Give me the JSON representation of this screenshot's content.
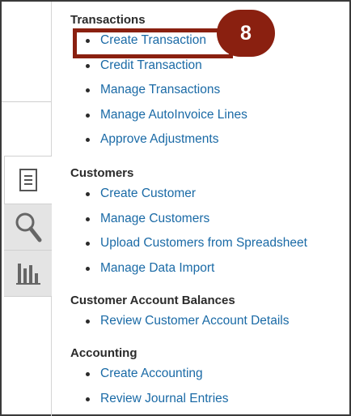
{
  "sections": [
    {
      "title": "Transactions",
      "tasks": [
        "Create Transaction",
        "Credit Transaction",
        "Manage Transactions",
        "Manage AutoInvoice Lines",
        "Approve Adjustments"
      ]
    },
    {
      "title": "Customers",
      "tasks": [
        "Create Customer",
        "Manage Customers",
        "Upload Customers from Spreadsheet",
        "Manage Data Import"
      ]
    },
    {
      "title": "Customer Account Balances",
      "tasks": [
        "Review Customer Account Details"
      ]
    },
    {
      "title": "Accounting",
      "tasks": [
        "Create Accounting",
        "Review Journal Entries"
      ]
    }
  ],
  "tabs": [
    {
      "icon": "task-list-icon",
      "active": true
    },
    {
      "icon": "search-icon",
      "active": false
    },
    {
      "icon": "reports-chart-icon",
      "active": false
    }
  ],
  "callout": {
    "step": "8"
  },
  "colors": {
    "link": "#1a6aa6",
    "callout": "#8a2010",
    "heading": "#2b2b2b"
  }
}
